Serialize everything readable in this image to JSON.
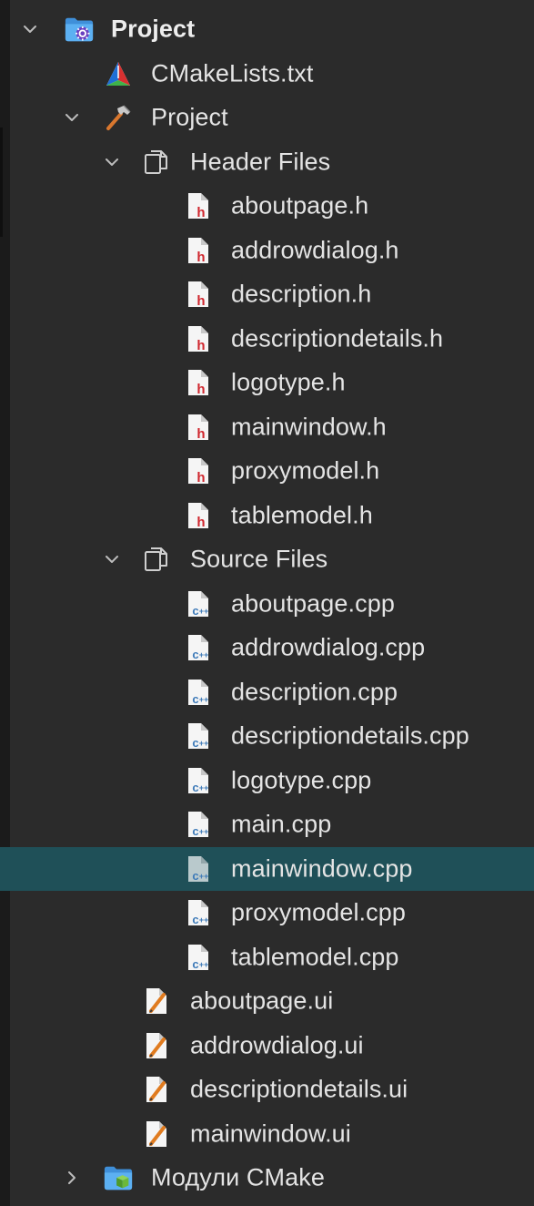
{
  "tree": {
    "root": {
      "label": "Project",
      "icon": "cmake-project-folder-icon",
      "expanded": true
    },
    "cmakelists": {
      "label": "CMakeLists.txt",
      "icon": "cmake-file-icon"
    },
    "project_target": {
      "label": "Project",
      "icon": "hammer-icon",
      "expanded": true
    },
    "header_group": {
      "label": "Header Files",
      "icon": "virtual-folder-icon",
      "expanded": true
    },
    "headers": [
      {
        "label": "aboutpage.h"
      },
      {
        "label": "addrowdialog.h"
      },
      {
        "label": "description.h"
      },
      {
        "label": "descriptiondetails.h"
      },
      {
        "label": "logotype.h"
      },
      {
        "label": "mainwindow.h"
      },
      {
        "label": "proxymodel.h"
      },
      {
        "label": "tablemodel.h"
      }
    ],
    "source_group": {
      "label": "Source Files",
      "icon": "virtual-folder-icon",
      "expanded": true
    },
    "sources": [
      {
        "label": "aboutpage.cpp"
      },
      {
        "label": "addrowdialog.cpp"
      },
      {
        "label": "description.cpp"
      },
      {
        "label": "descriptiondetails.cpp"
      },
      {
        "label": "logotype.cpp"
      },
      {
        "label": "main.cpp"
      },
      {
        "label": "mainwindow.cpp",
        "selected": true
      },
      {
        "label": "proxymodel.cpp"
      },
      {
        "label": "tablemodel.cpp"
      }
    ],
    "forms": [
      {
        "label": "aboutpage.ui"
      },
      {
        "label": "addrowdialog.ui"
      },
      {
        "label": "descriptiondetails.ui"
      },
      {
        "label": "mainwindow.ui"
      }
    ],
    "cmake_modules": {
      "label": "Модули CMake",
      "icon": "cmake-modules-folder-icon",
      "expanded": false
    }
  },
  "colors": {
    "background": "#2b2b2b",
    "selection": "#1f5058",
    "text": "#e4e4e4",
    "header_badge": "#d0272e",
    "cpp_badge": "#3d7ab8",
    "folder_blue": "#4a9fe8"
  }
}
